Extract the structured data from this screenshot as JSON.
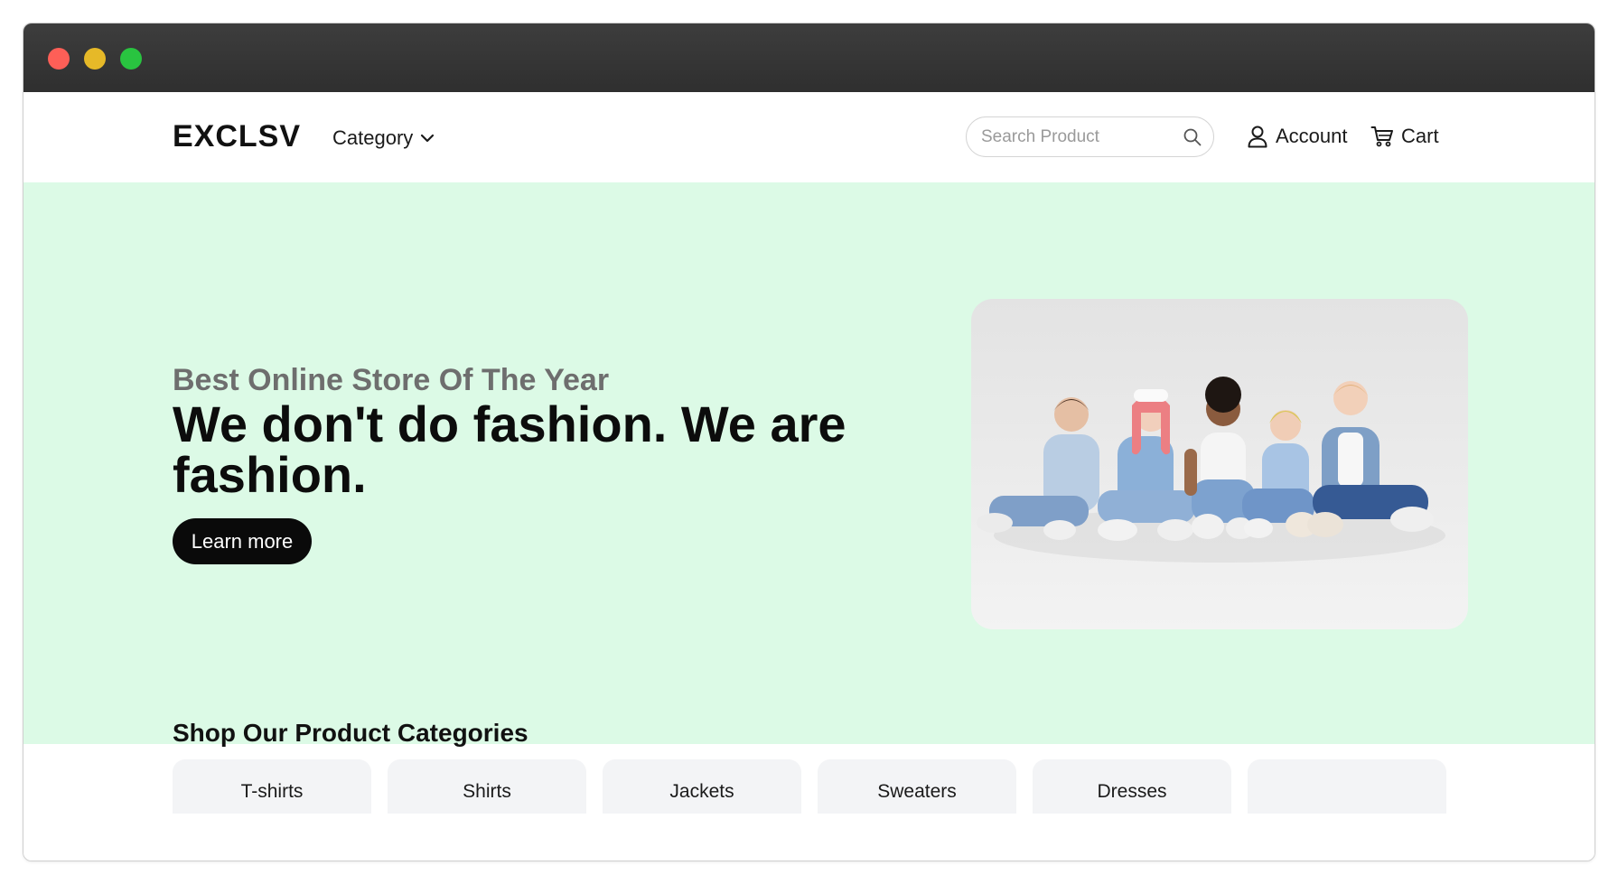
{
  "window": {
    "controls": [
      "close",
      "minimize",
      "maximize"
    ]
  },
  "header": {
    "logo": "EXCLSV",
    "category_label": "Category",
    "search_placeholder": "Search Product",
    "account_label": "Account",
    "cart_label": "Cart"
  },
  "hero": {
    "eyebrow": "Best Online Store Of The Year",
    "title": "We don't do fashion. We are fashion.",
    "cta_label": "Learn more",
    "background_color": "#dcfae6"
  },
  "categories": {
    "title": "Shop Our Product Categories",
    "items": [
      {
        "label": "T-shirts"
      },
      {
        "label": "Shirts"
      },
      {
        "label": "Jackets"
      },
      {
        "label": "Sweaters"
      },
      {
        "label": "Dresses"
      },
      {
        "label": ""
      }
    ]
  },
  "icons": {
    "category": "chevron-down-icon",
    "search": "search-icon",
    "account": "user-icon",
    "cart": "cart-icon"
  }
}
